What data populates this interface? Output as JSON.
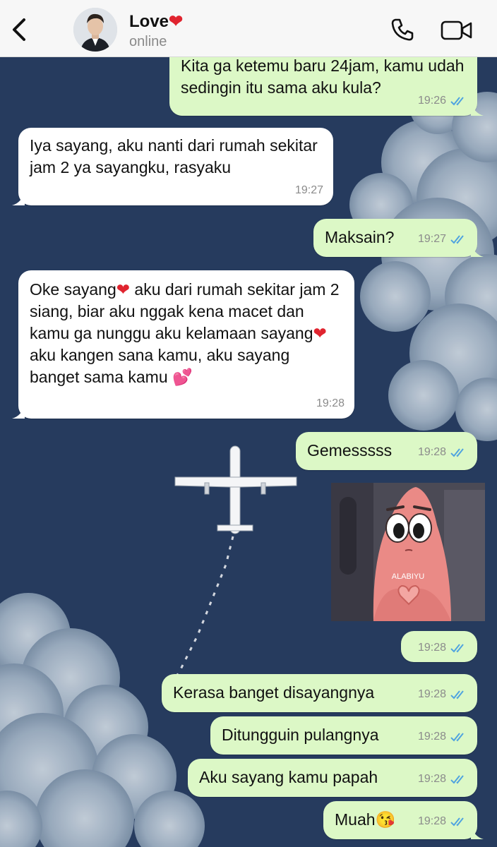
{
  "header": {
    "contact_name": "Love",
    "name_emoji": "❤",
    "status": "online",
    "icons": [
      "back-chevron-icon",
      "phone-icon",
      "video-camera-icon"
    ]
  },
  "messages": [
    {
      "id": "m1",
      "direction": "outgoing",
      "text": "Kita ga ketemu baru 24jam, kamu udah sedingin itu sama aku kula?",
      "time": "19:26",
      "read": true
    },
    {
      "id": "m2",
      "direction": "incoming",
      "text": "Iya sayang, aku nanti dari rumah sekitar jam 2 ya sayangku, rasyaku",
      "time": "19:27"
    },
    {
      "id": "m3",
      "direction": "outgoing",
      "text": "Maksain?",
      "time": "19:27",
      "read": true
    },
    {
      "id": "m4",
      "direction": "incoming",
      "parts": [
        "Oke sayang",
        "❤",
        "aku dari rumah sekitar jam 2 siang, biar aku nggak kena macet dan kamu ga nunggu aku kelamaan sayang",
        "❤",
        "aku kangen sana kamu, aku sayang banget sama kamu",
        "💕"
      ],
      "time": "19:28"
    },
    {
      "id": "m5",
      "direction": "outgoing",
      "text": "Gemesssss",
      "time": "19:28",
      "read": true
    },
    {
      "id": "m6",
      "direction": "outgoing",
      "type": "sticker",
      "sticker_caption": "ALABIYU",
      "time": "19:28",
      "read": true
    },
    {
      "id": "m7",
      "direction": "outgoing",
      "text": "Kerasa banget disayangnya",
      "time": "19:28",
      "read": true
    },
    {
      "id": "m8",
      "direction": "outgoing",
      "text": "Ditungguin pulangnya",
      "time": "19:28",
      "read": true
    },
    {
      "id": "m9",
      "direction": "outgoing",
      "text": "Aku sayang kamu papah",
      "time": "19:28",
      "read": true
    },
    {
      "id": "m10",
      "direction": "outgoing",
      "text": "Muah",
      "emoji": "😘",
      "time": "19:28",
      "read": true
    }
  ],
  "colors": {
    "outgoing_bubble": "#dcf8c6",
    "incoming_bubble": "#ffffff",
    "read_ticks": "#4fa3e0",
    "wallpaper_sky": "#2a3f63"
  }
}
